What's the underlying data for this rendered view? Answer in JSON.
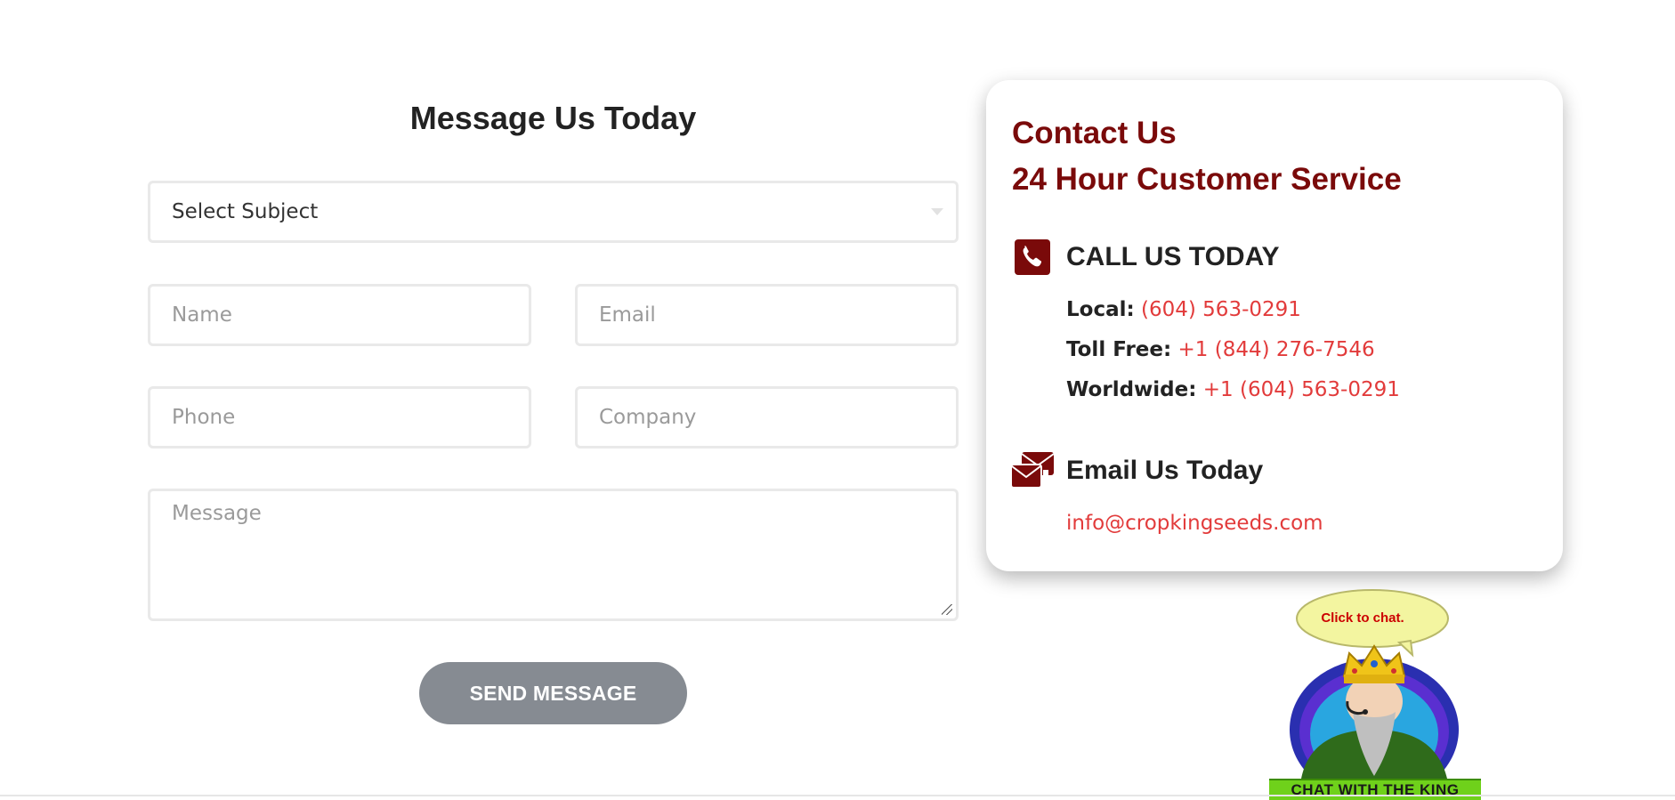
{
  "form": {
    "title": "Message Us Today",
    "subject_value": "Select Subject",
    "name_placeholder": "Name",
    "email_placeholder": "Email",
    "phone_placeholder": "Phone",
    "company_placeholder": "Company",
    "message_placeholder": "Message",
    "send_label": "SEND MESSAGE"
  },
  "contact": {
    "title_line1": "Contact Us",
    "title_line2": "24 Hour Customer Service",
    "call_heading": "CALL US TODAY",
    "local_label": "Local:",
    "local_number": "(604) 563-0291",
    "tollfree_label": "Toll Free:",
    "tollfree_number": "+1 (844) 276-7546",
    "worldwide_label": "Worldwide:",
    "worldwide_number": "+1 (604) 563-0291",
    "email_heading": "Email Us Today",
    "email_address": "info@cropkingseeds.com"
  },
  "chat": {
    "bubble_text": "Click to chat.",
    "banner_text": "CHAT WITH THE KING"
  },
  "colors": {
    "brand_red": "#7a0a0a",
    "link_red": "#e23b3b",
    "button_gray": "#868b92"
  },
  "icons": {
    "phone": "phone-icon",
    "email": "envelopes-icon",
    "chat": "king-mascot-icon"
  }
}
